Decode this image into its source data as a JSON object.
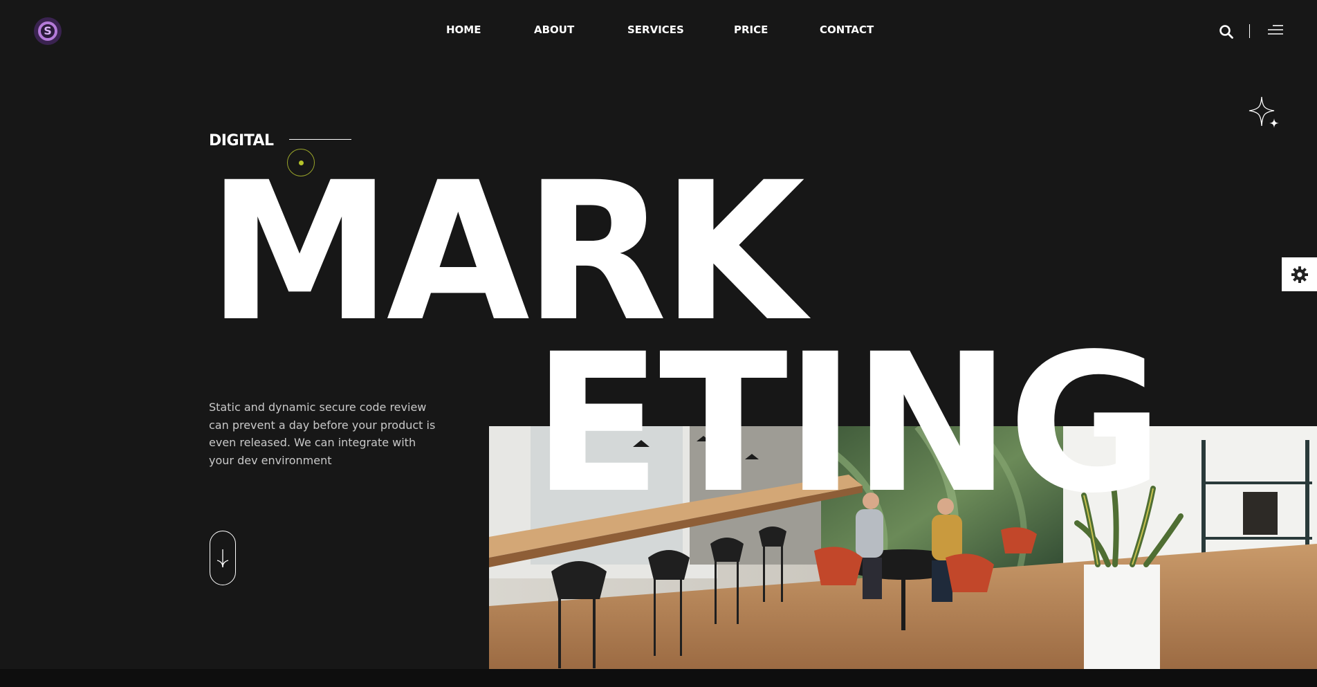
{
  "header": {
    "logo_letter": "S",
    "nav": [
      {
        "label": "HOME"
      },
      {
        "label": "ABOUT"
      },
      {
        "label": "SERVICES"
      },
      {
        "label": "PRICE"
      },
      {
        "label": "CONTACT"
      }
    ],
    "icons": {
      "search": "search-icon",
      "menu": "menu-icon"
    }
  },
  "hero": {
    "eyebrow": "DIGITAL",
    "title_line1": "MARK",
    "title_line2": "ETING",
    "description": "Static and dynamic secure code review can prevent a day before your product is even released. We can integrate with your dev environment",
    "scroll_icon": "arrow-down-icon",
    "decor_icon": "sparkle-icon",
    "photo_alt_icon": "office-photo"
  },
  "side": {
    "settings_icon": "gear-icon"
  },
  "colors": {
    "background": "#171717",
    "text": "#ffffff",
    "muted_text": "#c9c9c9",
    "logo_accent": "#b47ad9",
    "cursor_accent": "#b6c42a"
  }
}
